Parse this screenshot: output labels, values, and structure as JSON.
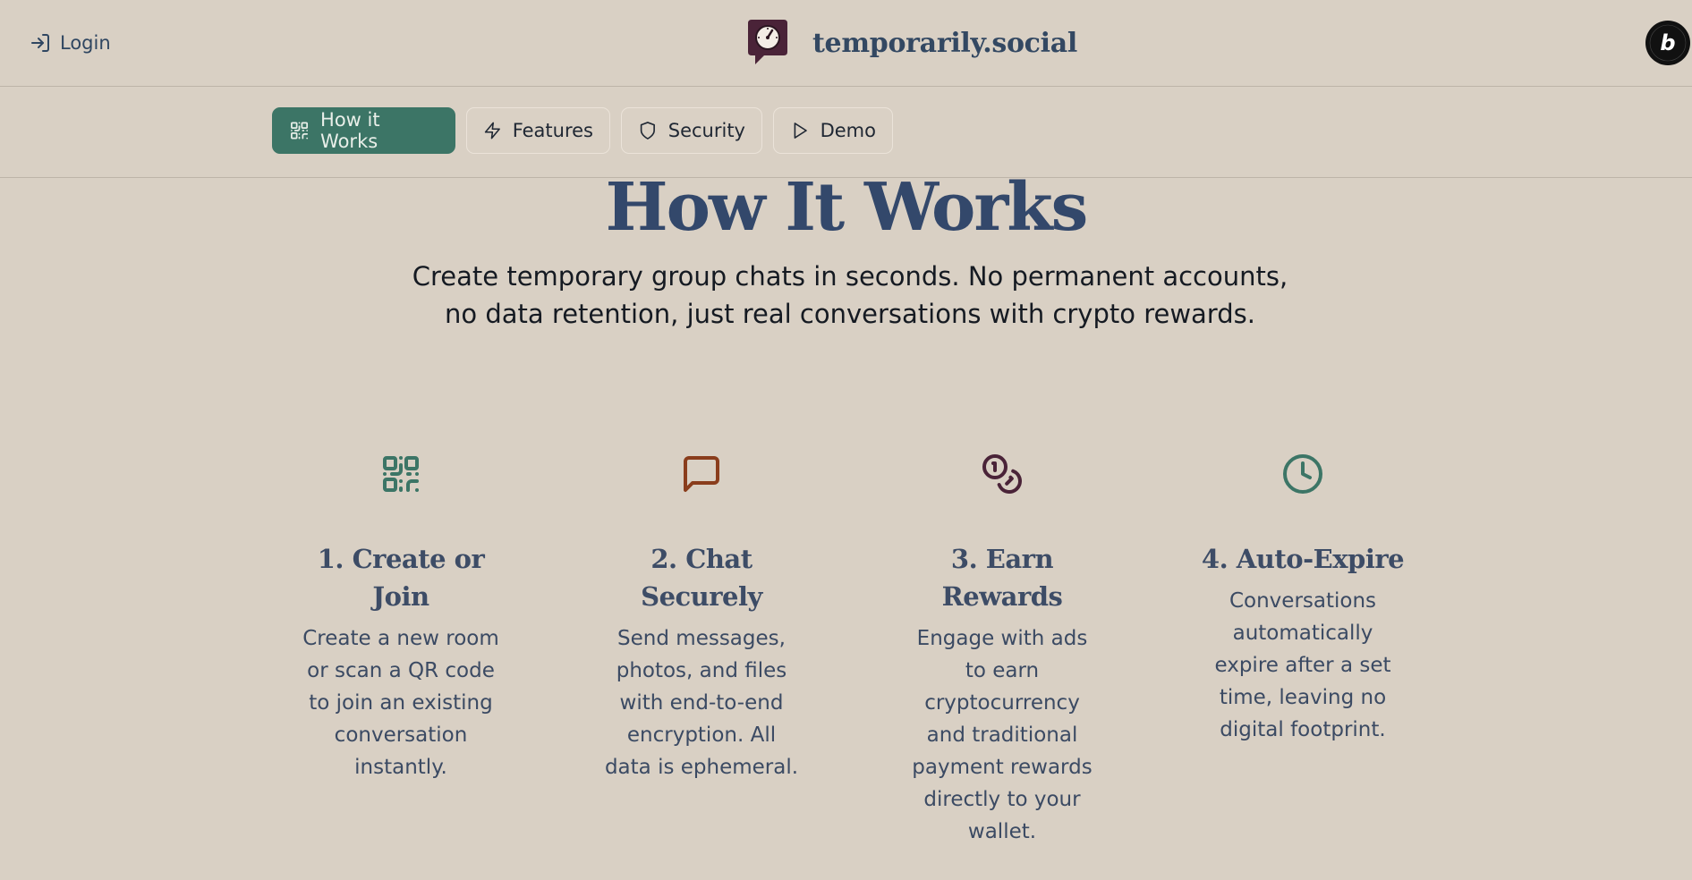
{
  "header": {
    "login_label": "Login",
    "brand_name": "temporarily.social",
    "badge_text": "POWERED BY BOLT"
  },
  "nav": {
    "items": [
      {
        "label": "How it Works",
        "icon": "qr-code-icon",
        "active": true
      },
      {
        "label": "Features",
        "icon": "lightning-icon",
        "active": false
      },
      {
        "label": "Security",
        "icon": "shield-icon",
        "active": false
      },
      {
        "label": "Demo",
        "icon": "play-icon",
        "active": false
      }
    ]
  },
  "hero": {
    "title": "How It Works",
    "subtitle": "Create temporary group chats in seconds. No permanent accounts, no data retention, just real conversations with crypto rewards."
  },
  "steps": [
    {
      "icon": "qr-code-icon",
      "title": "1. Create or Join",
      "text": "Create a new room or scan a QR code to join an existing conversation instantly.",
      "color": "#3c7566"
    },
    {
      "icon": "message-square-icon",
      "title": "2. Chat Securely",
      "text": "Send messages, photos, and files with end-to-end encryption. All data is ephemeral.",
      "color": "#8a3d1c"
    },
    {
      "icon": "coins-icon",
      "title": "3. Earn Rewards",
      "text": "Engage with ads to earn cryptocurrency and traditional payment rewards directly to your wallet.",
      "color": "#4a2338"
    },
    {
      "icon": "clock-icon",
      "title": "4. Auto-Expire",
      "text": "Conversations automatically expire after a set time, leaving no digital footprint.",
      "color": "#3c7566"
    }
  ],
  "colors": {
    "background": "#d9d0c4",
    "accent": "#3c7566",
    "heading": "#33486b"
  }
}
